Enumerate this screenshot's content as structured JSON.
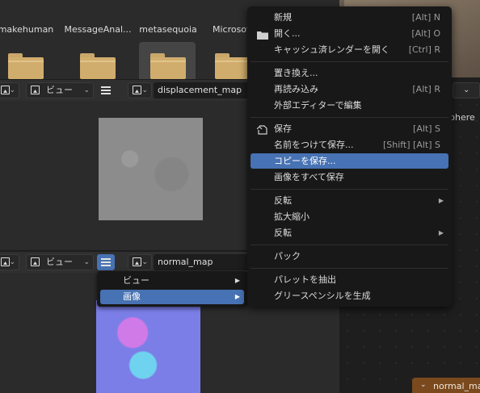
{
  "file_browser": {
    "items": [
      {
        "label": "makehuman"
      },
      {
        "label": "MessageAnal..."
      },
      {
        "label": "metasequoia"
      },
      {
        "label": "Microsoft"
      }
    ]
  },
  "editor_top": {
    "view_menu_label": "ビュー",
    "image_name": "displacement_map"
  },
  "editor_bottom": {
    "view_menu_label": "ビュー",
    "image_name": "normal_map"
  },
  "sub_menu": {
    "items": [
      {
        "label": "ビュー",
        "highlighted": false
      },
      {
        "label": "画像",
        "highlighted": true
      }
    ]
  },
  "image_menu": {
    "items": [
      {
        "label": "新規",
        "shortcut": "[Alt] N"
      },
      {
        "label": "開く...",
        "shortcut": "[Alt] O",
        "icon": "folder-icon"
      },
      {
        "label": "キャッシュ済レンダーを開く",
        "shortcut": "[Ctrl] R"
      },
      {
        "label": "置き換え..."
      },
      {
        "label": "再読み込み",
        "shortcut": "[Alt] R"
      },
      {
        "label": "外部エディターで編集"
      },
      {
        "label": "保存",
        "shortcut": "[Alt] S",
        "icon": "save-icon"
      },
      {
        "label": "名前をつけて保存...",
        "shortcut": "[Shift] [Alt] S"
      },
      {
        "label": "コピーを保存...",
        "highlighted": true
      },
      {
        "label": "画像をすべて保存"
      },
      {
        "label": "反転",
        "submenu": true
      },
      {
        "label": "拡大縮小"
      },
      {
        "label": "反転",
        "submenu": true
      },
      {
        "label": "パック"
      },
      {
        "label": "パレットを抽出"
      },
      {
        "label": "グリースペンシルを生成"
      }
    ]
  },
  "right_panel": {
    "sphere_label": "phere",
    "node_tab_label": "normal_ma"
  },
  "colors": {
    "accent": "#4772b3",
    "menu_bg": "#181818",
    "folder": "#d1ad6d"
  }
}
